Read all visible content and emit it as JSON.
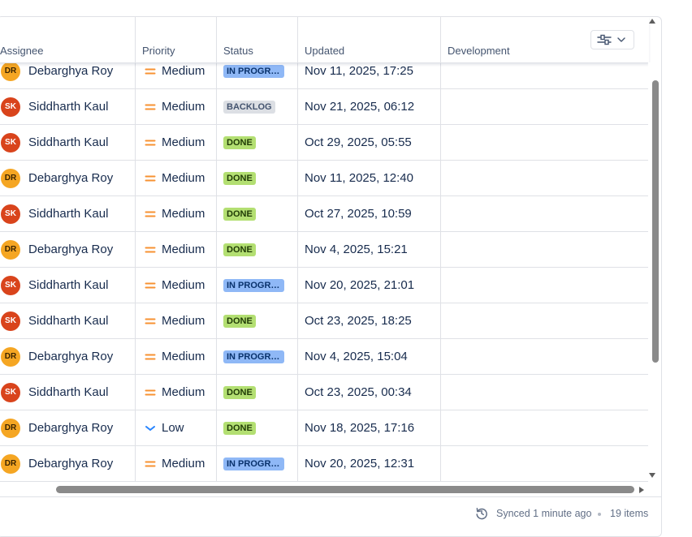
{
  "columns": {
    "assignee": "Assignee",
    "priority": "Priority",
    "status": "Status",
    "updated": "Updated",
    "development": "Development"
  },
  "column_settings_icon": "sliders-icon",
  "rows": [
    {
      "assignee": "Debarghya Roy",
      "initials": "DR",
      "priority": "Medium",
      "status": "IN PROGRESS",
      "status_kind": "inprogress",
      "updated": "Nov 11, 2025, 17:25"
    },
    {
      "assignee": "Siddharth Kaul",
      "initials": "SK",
      "priority": "Medium",
      "status": "BACKLOG",
      "status_kind": "backlog",
      "updated": "Nov 21, 2025, 06:12"
    },
    {
      "assignee": "Siddharth Kaul",
      "initials": "SK",
      "priority": "Medium",
      "status": "DONE",
      "status_kind": "done",
      "updated": "Oct 29, 2025, 05:55"
    },
    {
      "assignee": "Debarghya Roy",
      "initials": "DR",
      "priority": "Medium",
      "status": "DONE",
      "status_kind": "done",
      "updated": "Nov 11, 2025, 12:40"
    },
    {
      "assignee": "Siddharth Kaul",
      "initials": "SK",
      "priority": "Medium",
      "status": "DONE",
      "status_kind": "done",
      "updated": "Oct 27, 2025, 10:59"
    },
    {
      "assignee": "Debarghya Roy",
      "initials": "DR",
      "priority": "Medium",
      "status": "DONE",
      "status_kind": "done",
      "updated": "Nov 4, 2025, 15:21"
    },
    {
      "assignee": "Siddharth Kaul",
      "initials": "SK",
      "priority": "Medium",
      "status": "IN PROGRESS",
      "status_kind": "inprogress",
      "updated": "Nov 20, 2025, 21:01"
    },
    {
      "assignee": "Siddharth Kaul",
      "initials": "SK",
      "priority": "Medium",
      "status": "DONE",
      "status_kind": "done",
      "updated": "Oct 23, 2025, 18:25"
    },
    {
      "assignee": "Debarghya Roy",
      "initials": "DR",
      "priority": "Medium",
      "status": "IN PROGRESS",
      "status_kind": "inprogress",
      "updated": "Nov 4, 2025, 15:04"
    },
    {
      "assignee": "Siddharth Kaul",
      "initials": "SK",
      "priority": "Medium",
      "status": "DONE",
      "status_kind": "done",
      "updated": "Oct 23, 2025, 00:34"
    },
    {
      "assignee": "Debarghya Roy",
      "initials": "DR",
      "priority": "Low",
      "status": "DONE",
      "status_kind": "done",
      "updated": "Nov 18, 2025, 17:16"
    },
    {
      "assignee": "Debarghya Roy",
      "initials": "DR",
      "priority": "Medium",
      "status": "IN PROGRESS",
      "status_kind": "inprogress",
      "updated": "Nov 20, 2025, 12:31"
    }
  ],
  "footer": {
    "sync_icon": "refresh-icon",
    "synced": "Synced 1 minute ago",
    "count": "19 items"
  },
  "colors": {
    "medium_priority": "#f79232",
    "low_priority": "#2684ff",
    "in_progress": "#8fb8f6",
    "done": "#b3df72",
    "backlog": "#dcdfe4"
  }
}
